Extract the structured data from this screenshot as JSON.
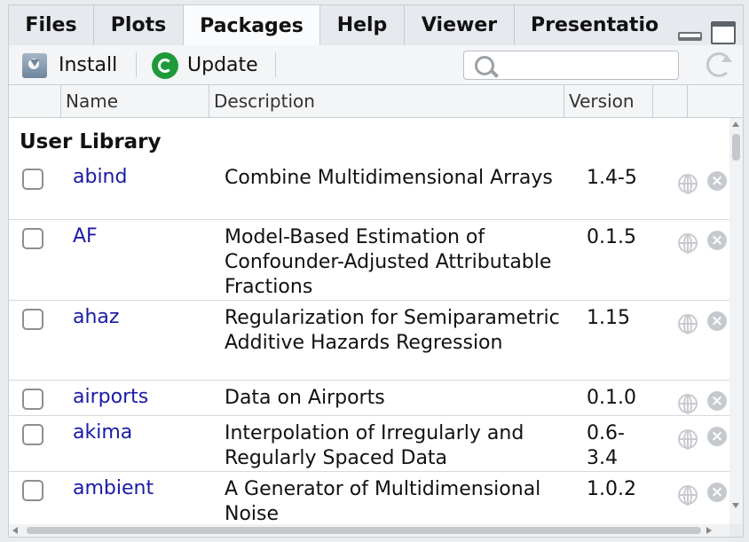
{
  "tabs": [
    {
      "label": "Files",
      "active": false
    },
    {
      "label": "Plots",
      "active": false
    },
    {
      "label": "Packages",
      "active": true
    },
    {
      "label": "Help",
      "active": false
    },
    {
      "label": "Viewer",
      "active": false
    },
    {
      "label": "Presentatio",
      "active": false
    }
  ],
  "toolbar": {
    "install_label": "Install",
    "install_icon": "install-icon",
    "update_label": "Update",
    "update_icon": "update-icon",
    "search_value": "",
    "search_icon": "search-icon",
    "refresh_icon": "refresh-icon"
  },
  "table": {
    "columns": [
      "",
      "Name",
      "Description",
      "Version",
      "",
      ""
    ],
    "section_title": "User Library",
    "rows": [
      {
        "name": "abind",
        "description": "Combine Multidimensional Arrays",
        "version": "1.4-5",
        "checked": false
      },
      {
        "name": "AF",
        "description": "Model-Based Estimation of Confounder-Adjusted Attributable Fractions",
        "version": "0.1.5",
        "checked": false
      },
      {
        "name": "ahaz",
        "description": "Regularization for Semiparametric Additive Hazards Regression",
        "version": "1.15",
        "checked": false
      },
      {
        "name": "airports",
        "description": "Data on Airports",
        "version": "0.1.0",
        "checked": false
      },
      {
        "name": "akima",
        "description": "Interpolation of Irregularly and Regularly Spaced Data",
        "version": "0.6-3.4",
        "checked": false
      },
      {
        "name": "ambient",
        "description": "A Generator of Multidimensional Noise",
        "version": "1.0.2",
        "checked": false
      }
    ]
  },
  "colors": {
    "package_link": "#1a1ba6",
    "update_green": "#1f9a3b",
    "remove_gray": "#c6cacf"
  }
}
